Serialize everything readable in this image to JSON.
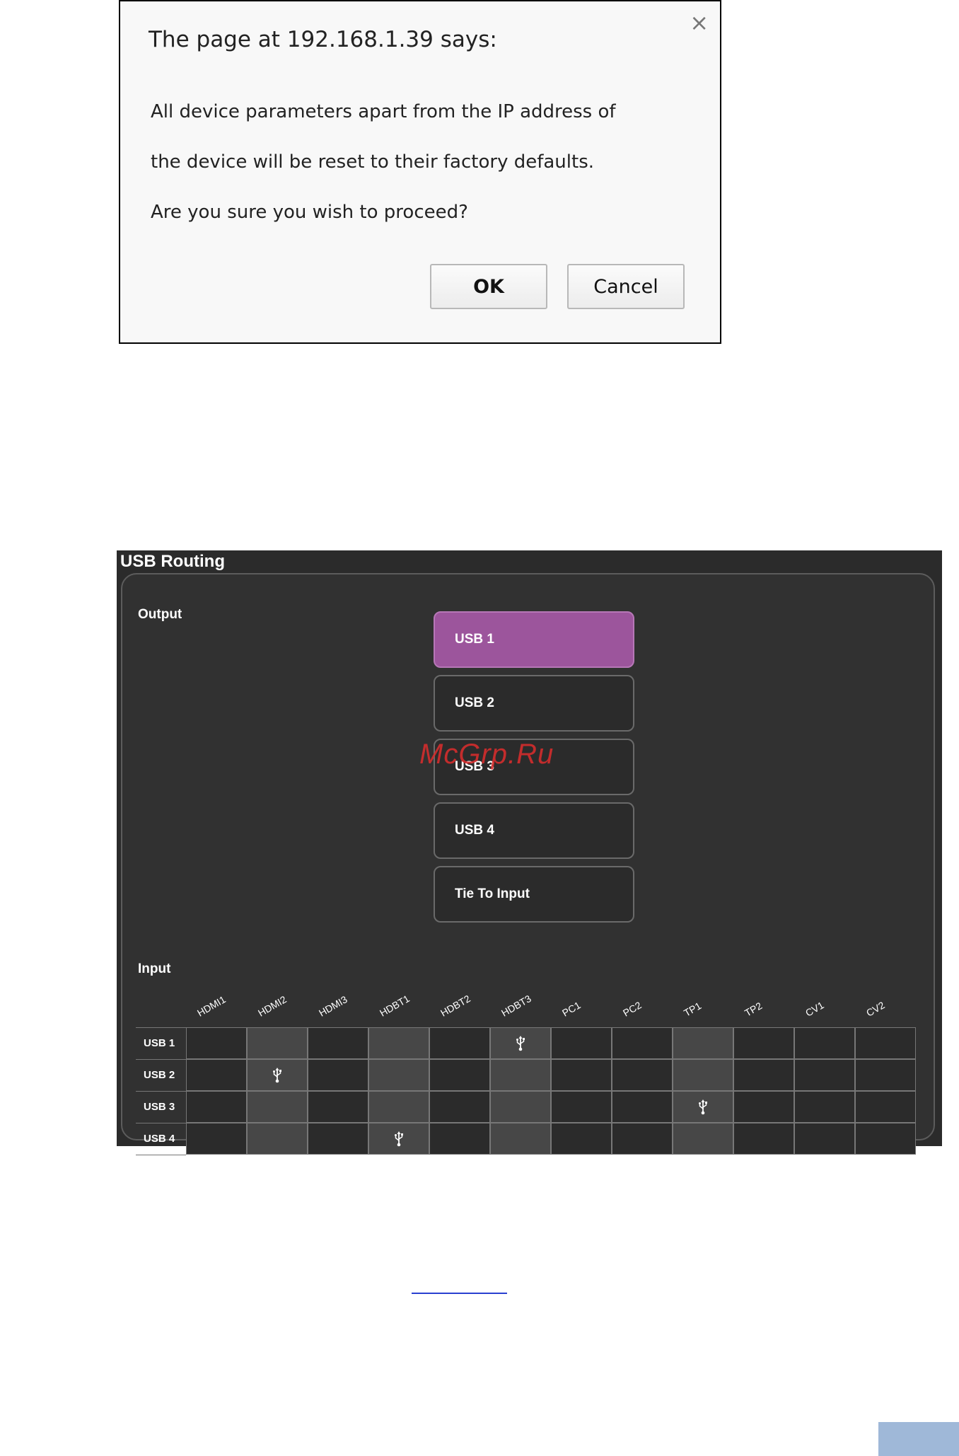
{
  "dialog": {
    "title": "The page at 192.168.1.39 says:",
    "close_glyph": "×",
    "message_lines": [
      "All device parameters apart from the IP address of",
      "the device will be reset to their factory defaults.",
      "Are you sure you wish to proceed?"
    ],
    "ok_label": "OK",
    "cancel_label": "Cancel"
  },
  "usb_routing": {
    "title": "USB Routing",
    "output_label": "Output",
    "input_label": "Input",
    "outputs": [
      "USB 1",
      "USB 2",
      "USB 3",
      "USB 4",
      "Tie To Input"
    ],
    "selected_output": "USB 1",
    "accent_color": "#9c559c",
    "columns": [
      "HDMI1",
      "HDMI2",
      "HDMI3",
      "HDBT1",
      "HDBT2",
      "HDBT3",
      "PC1",
      "PC2",
      "TP1",
      "TP2",
      "CV1",
      "CV2"
    ],
    "rows": [
      "USB 1",
      "USB 2",
      "USB 3",
      "USB 4"
    ],
    "routes": [
      {
        "row": "USB 1",
        "column": "HDBT3"
      },
      {
        "row": "USB 2",
        "column": "HDMI2"
      },
      {
        "row": "USB 3",
        "column": "TP1"
      },
      {
        "row": "USB 4",
        "column": "HDBT1"
      }
    ],
    "route_icon": "usb-icon"
  },
  "watermark": "McGrp.Ru"
}
